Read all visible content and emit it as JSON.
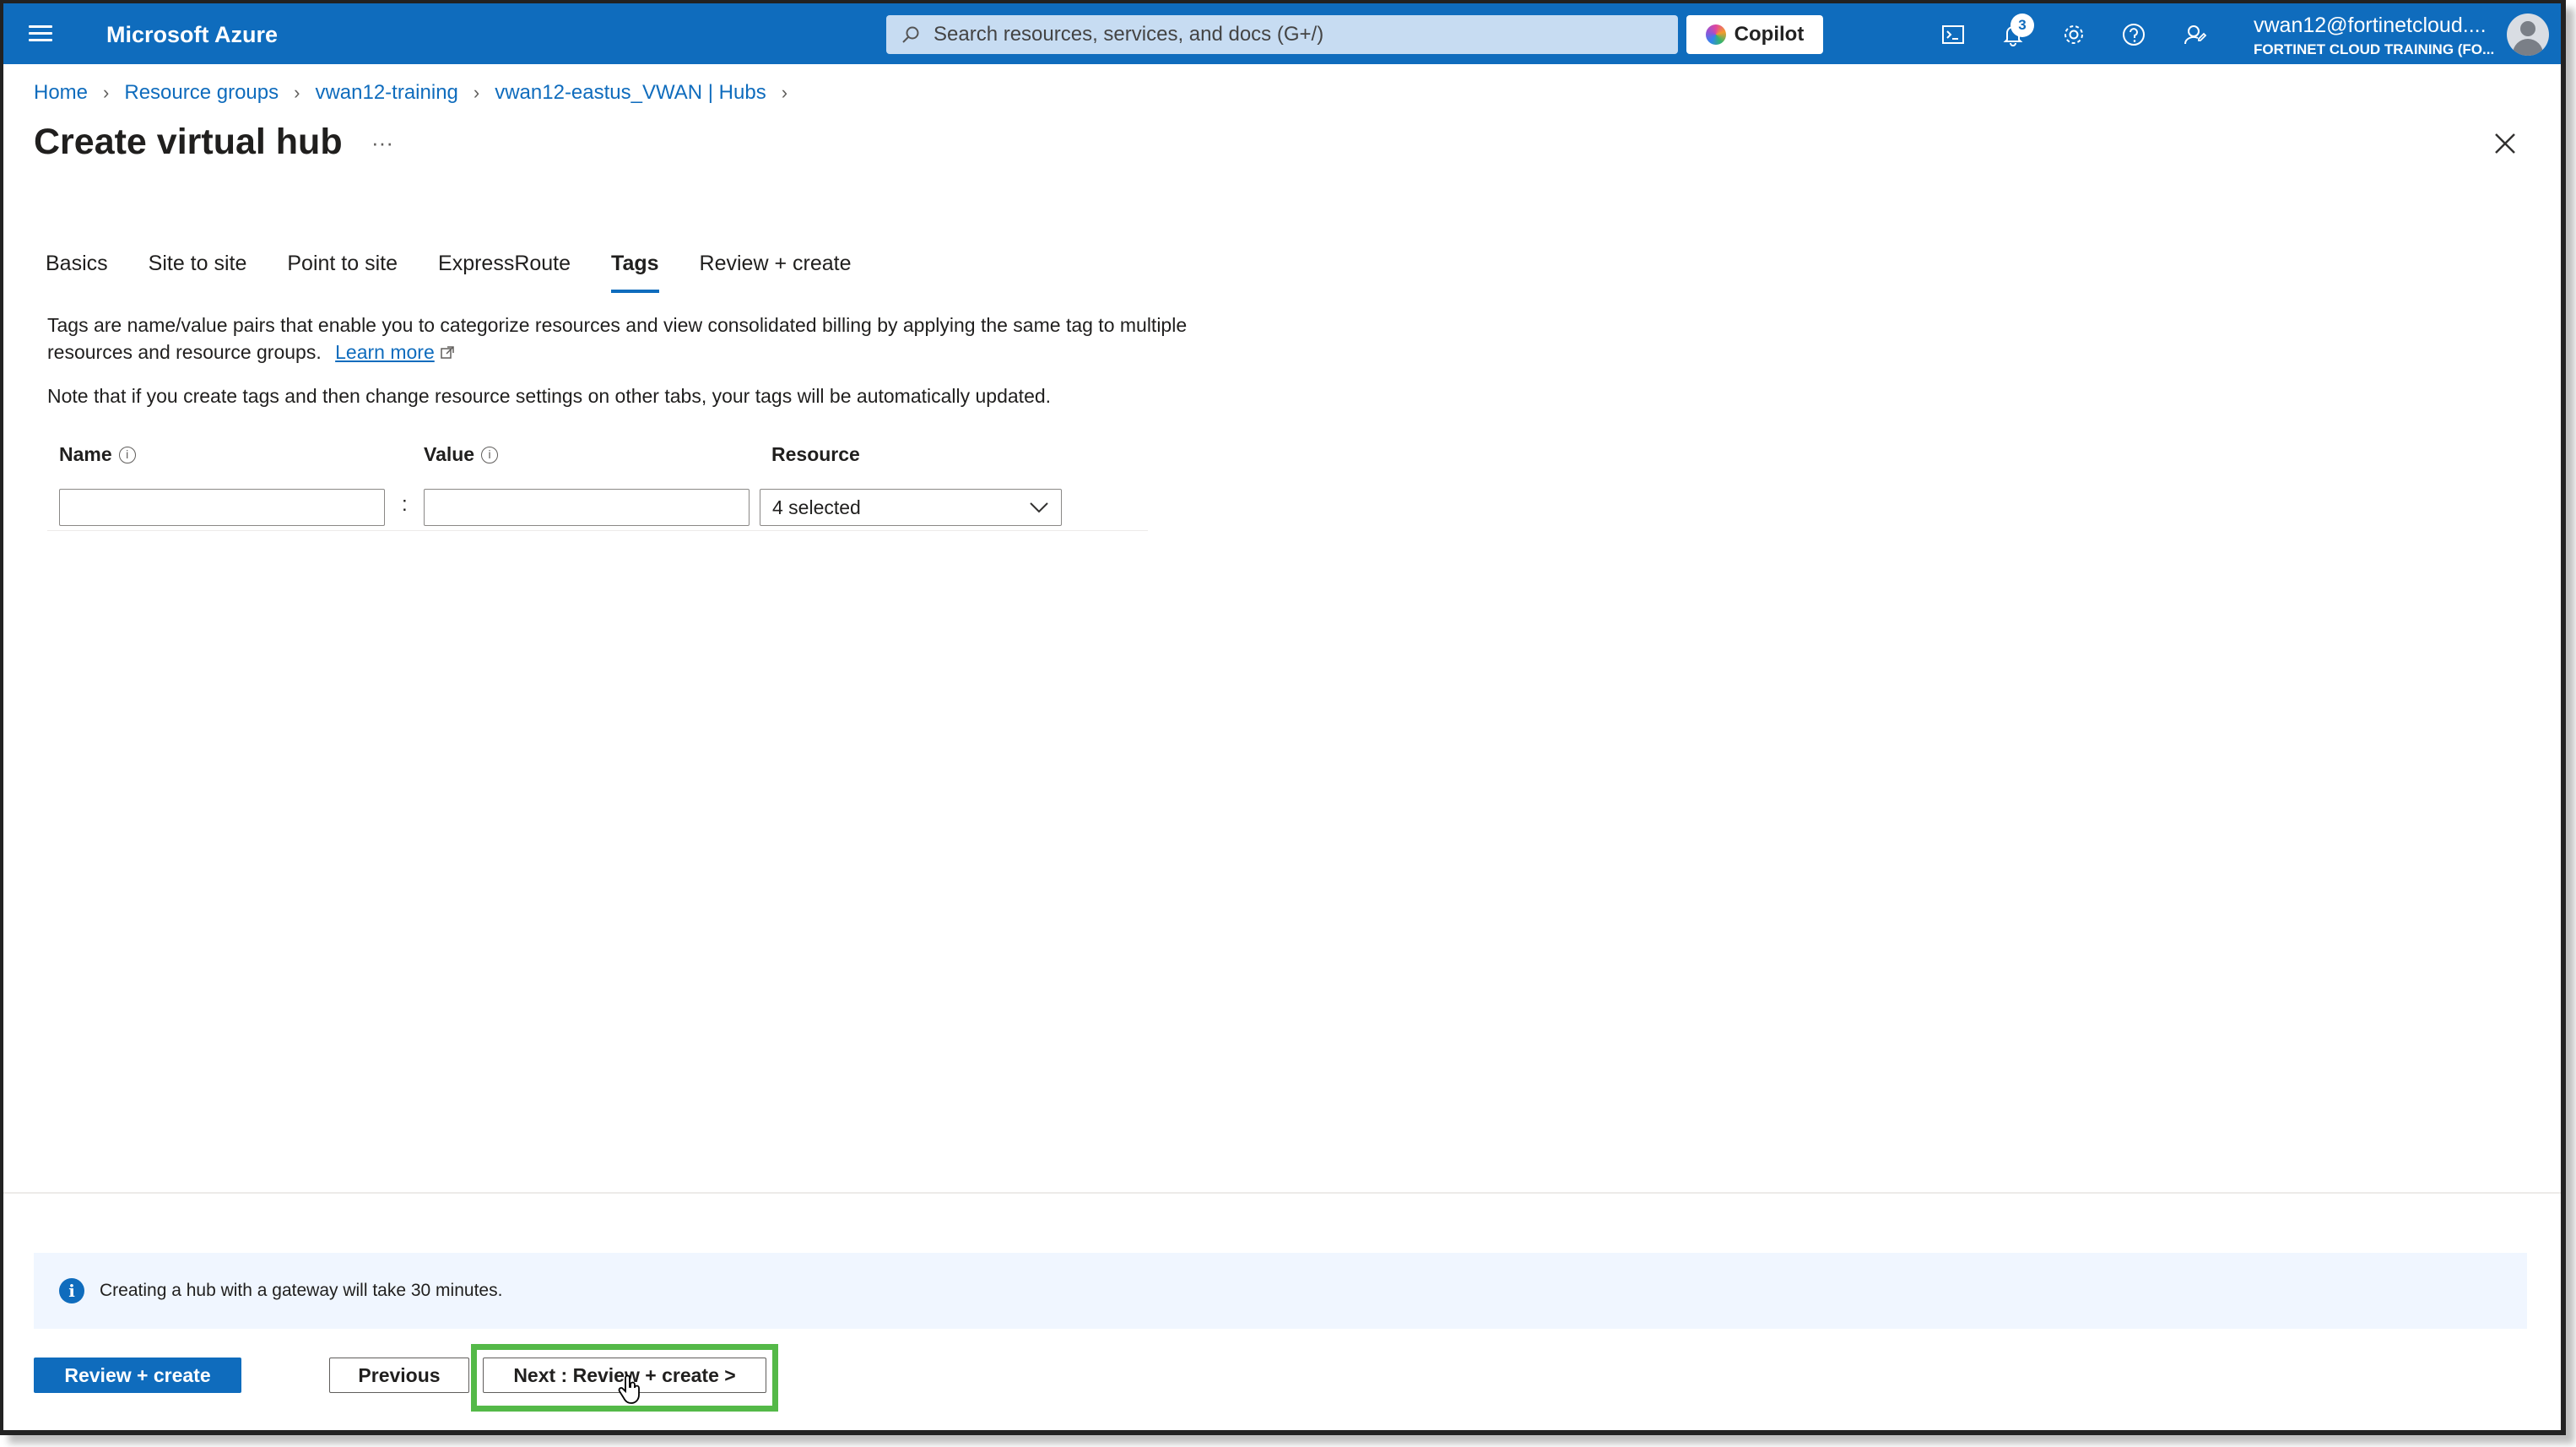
{
  "topbar": {
    "brand": "Microsoft Azure",
    "search_placeholder": "Search resources, services, and docs (G+/)",
    "copilot_label": "Copilot",
    "notification_count": "3",
    "user_email": "vwan12@fortinetcloud....",
    "user_tenant": "FORTINET CLOUD TRAINING (FO..."
  },
  "breadcrumb": [
    "Home",
    "Resource groups",
    "vwan12-training",
    "vwan12-eastus_VWAN | Hubs"
  ],
  "page": {
    "title": "Create virtual hub",
    "ellipsis": "···"
  },
  "tabs": [
    "Basics",
    "Site to site",
    "Point to site",
    "ExpressRoute",
    "Tags",
    "Review + create"
  ],
  "active_tab": "Tags",
  "tags": {
    "description": "Tags are name/value pairs that enable you to categorize resources and view consolidated billing by applying the same tag to multiple resources and resource groups.",
    "learn_more": "Learn more",
    "note": "Note that if you create tags and then change resource settings on other tabs, your tags will be automatically updated.",
    "col_name": "Name",
    "col_value": "Value",
    "col_resource": "Resource",
    "name_value": "",
    "value_value": "",
    "separator": ":",
    "resource_selected": "4 selected"
  },
  "footer": {
    "info": "Creating a hub with a gateway will take 30 minutes.",
    "review_create": "Review + create",
    "previous": "Previous",
    "next": "Next : Review + create >"
  },
  "colors": {
    "accent": "#0f6cbd",
    "highlight": "#54b948"
  }
}
